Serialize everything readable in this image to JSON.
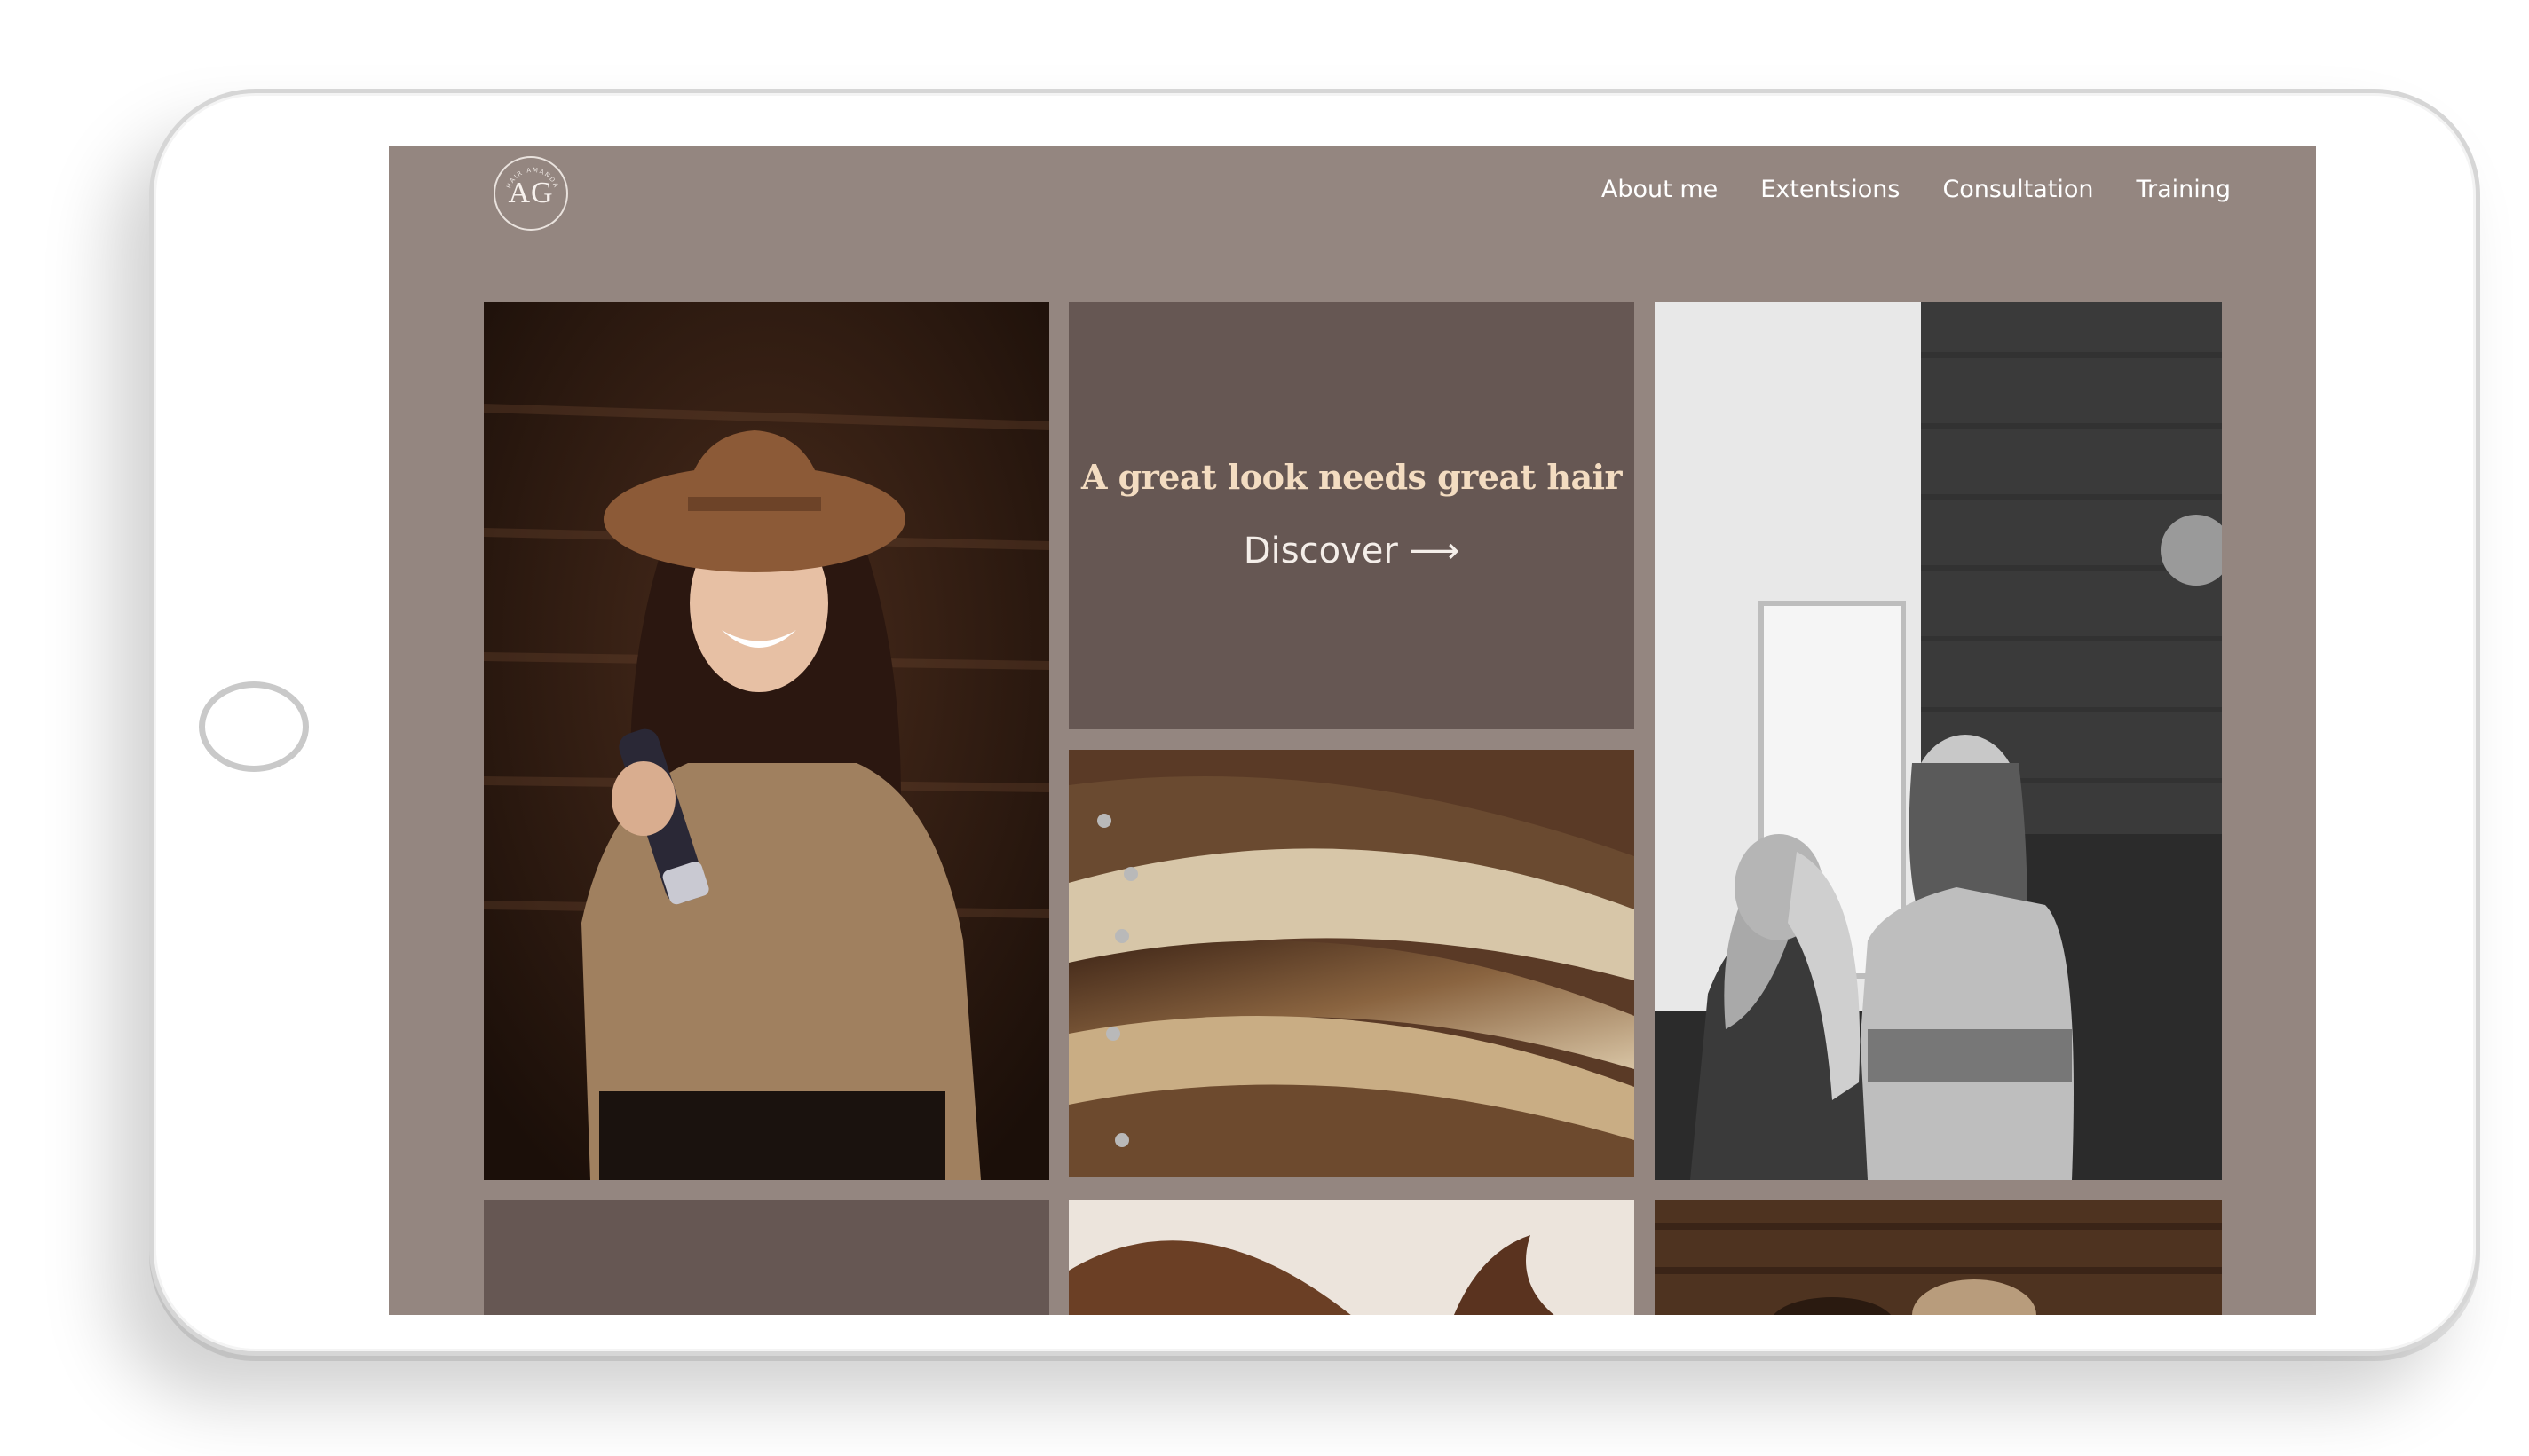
{
  "brand": {
    "logo_letters": "AG",
    "logo_arc_text": "HAIR AMANDA"
  },
  "nav": {
    "items": [
      {
        "label": "About me"
      },
      {
        "label": "Extentsions"
      },
      {
        "label": "Consultation"
      },
      {
        "label": "Training"
      }
    ]
  },
  "hero": {
    "heading": "A great look needs great hair",
    "cta_label": "Discover",
    "cta_arrow": "⟶"
  },
  "colors": {
    "page_background": "#948680",
    "tile_background": "#665753",
    "heading_color": "#f3dcc1",
    "nav_text": "#ffffff"
  },
  "icons": {
    "arrow": "arrow-right-icon",
    "logo": "ag-monogram-logo"
  }
}
